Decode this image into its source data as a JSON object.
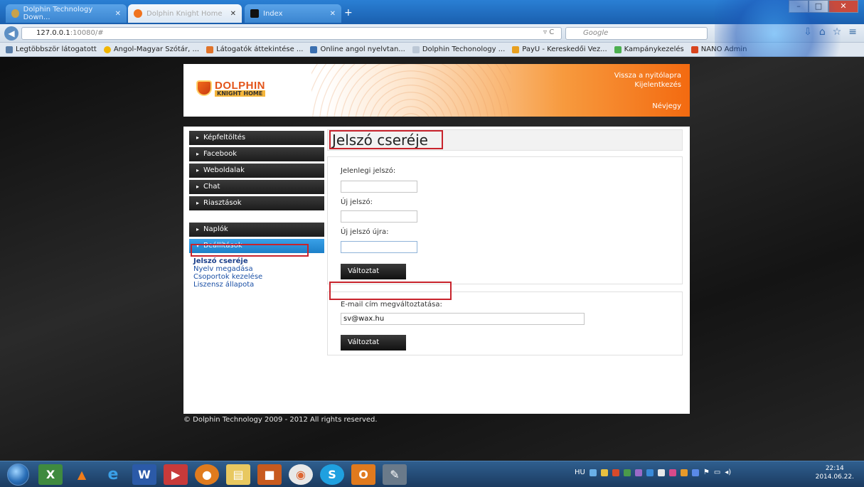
{
  "browser": {
    "tabs": [
      {
        "label": "Dolphin Technology Down...",
        "state": "inactive"
      },
      {
        "label": "Dolphin Knight Home",
        "state": "active"
      },
      {
        "label": "Index",
        "state": "inactive"
      }
    ],
    "url_host": "127.0.0.1",
    "url_rest": ":10080/#",
    "search_placeholder": "Google",
    "bookmarks": [
      "Legtöbbször látogatott",
      "Angol-Magyar Szótár, ...",
      "Látogatók áttekintése ...",
      "Online angol nyelvtan...",
      "Dolphin Techonology ...",
      "PayU - Kereskedői Vez...",
      "Kampánykezelés",
      "NANO Admin"
    ]
  },
  "header": {
    "logo_line1": "DOLPHIN",
    "logo_line2": "KNIGHT HOME",
    "link_home": "Vissza a nyitólapra",
    "link_logout": "Kijelentkezés",
    "link_about": "Névjegy"
  },
  "menu": {
    "items": [
      "Képfeltöltés",
      "Facebook",
      "Weboldalak",
      "Chat",
      "Riasztások"
    ],
    "items2": [
      "Naplók",
      "Beállítások"
    ],
    "sublinks": [
      "Jelszó cseréje",
      "Nyelv megadása",
      "Csoportok kezelése",
      "Liszensz állapota"
    ]
  },
  "main": {
    "title": "Jelszó cseréje",
    "current_password_label": "Jelenlegi jelszó:",
    "new_password_label": "Új jelszó:",
    "new_password_again_label": "Új jelszó újra:",
    "submit_label": "Változtat",
    "email_label": "E-mail cím megváltoztatása:",
    "email_value": "sv@wax.hu",
    "email_submit_label": "Változtat"
  },
  "footer": "© Dolphin Technology 2009 - 2012 All rights reserved.",
  "taskbar": {
    "lang": "HU",
    "time": "22:14",
    "date": "2014.06.22."
  },
  "colors": {
    "accent": "#1c7fc8",
    "highlight_box": "#c8232c",
    "header_orange": "#f36a10"
  }
}
